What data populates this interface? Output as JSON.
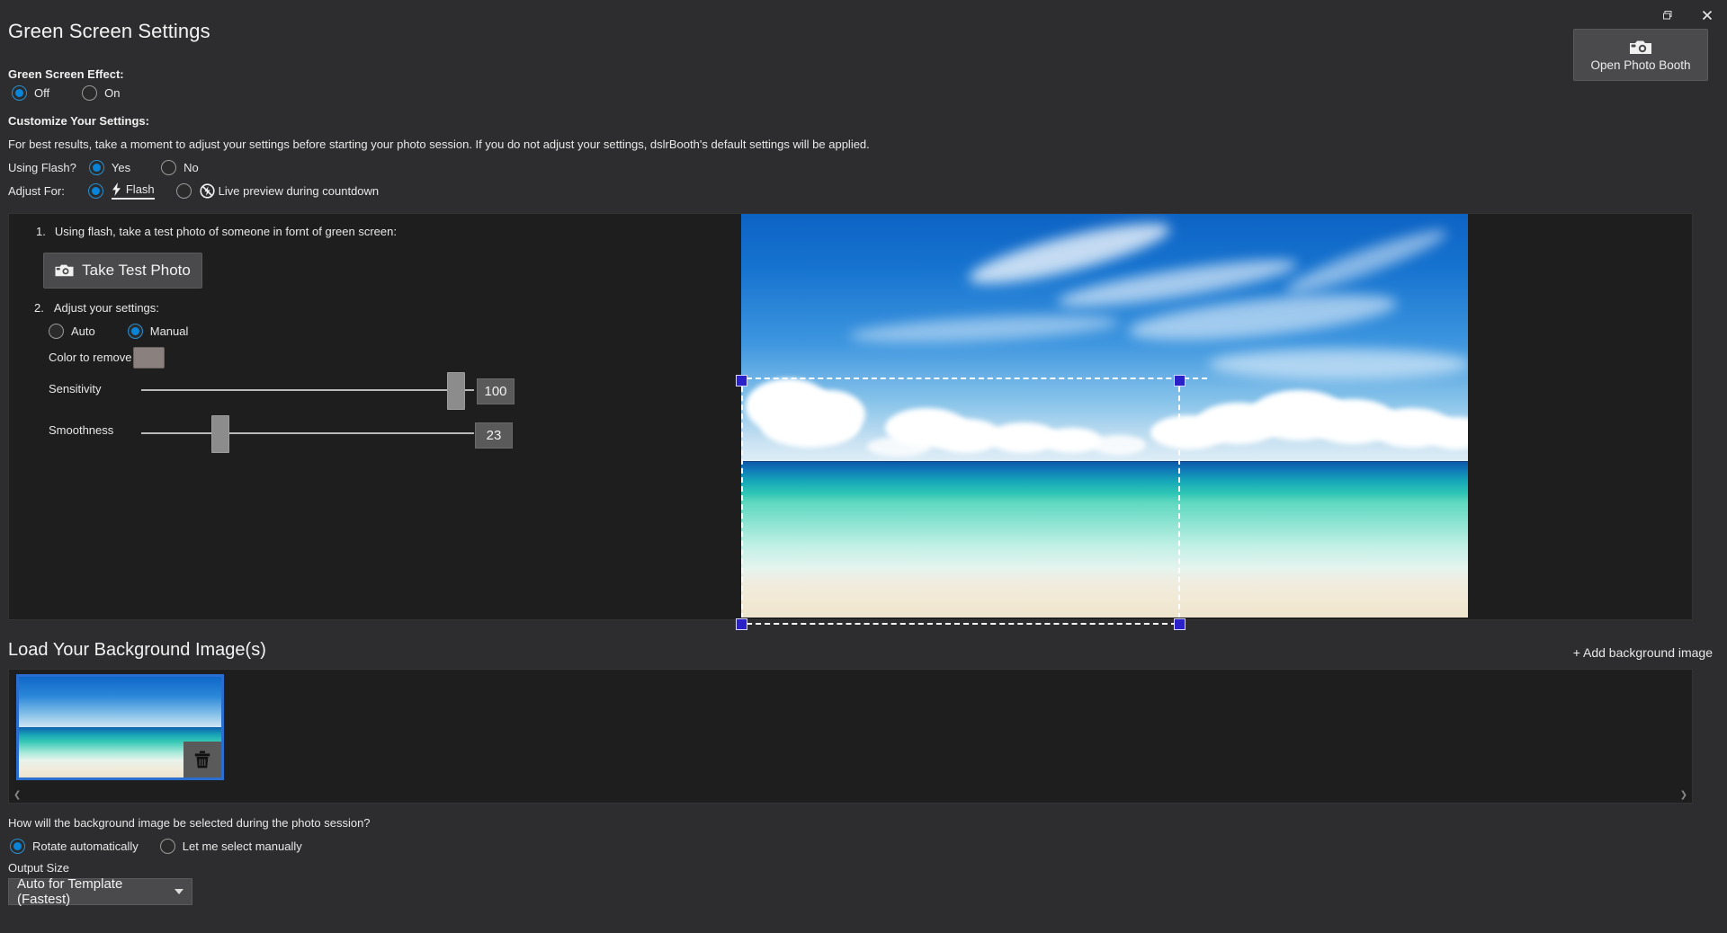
{
  "window": {
    "restore_icon": "restore-window-icon",
    "close_icon": "close-window-icon"
  },
  "page_title": "Green Screen Settings",
  "photo_booth": {
    "label": "Open Photo Booth",
    "icon": "camera-icon"
  },
  "green_screen_effect": {
    "label": "Green Screen Effect:",
    "options": [
      "Off",
      "On"
    ],
    "selected": "Off"
  },
  "customize": {
    "heading": "Customize Your Settings:",
    "description": "For best results, take a moment to adjust your settings before starting your photo session. If you do not adjust your settings, dslrBooth's default settings will be applied."
  },
  "using_flash": {
    "label": "Using Flash?",
    "options": [
      "Yes",
      "No"
    ],
    "selected": "Yes"
  },
  "adjust_for": {
    "label": "Adjust For:",
    "options": [
      {
        "label": "Flash",
        "icon": "flash-bolt-icon"
      },
      {
        "label": "Live preview during countdown",
        "icon": "flash-off-icon"
      }
    ],
    "selected": "Flash"
  },
  "steps": {
    "one": {
      "number": "1.",
      "text": "Using flash, take a test photo of someone in fornt of green screen:",
      "button_label": "Take Test Photo",
      "button_icon": "camera-icon"
    },
    "two": {
      "number": "2.",
      "text": "Adjust your settings:",
      "mode_options": [
        "Auto",
        "Manual"
      ],
      "mode_selected": "Manual"
    }
  },
  "color_to_remove": {
    "label": "Color to remove",
    "swatch_color": "#8a807e"
  },
  "sliders": [
    {
      "label": "Sensitivity",
      "value": "100",
      "percent": 97
    },
    {
      "label": "Smoothness",
      "value": "23",
      "percent": 23
    }
  ],
  "preview": {
    "alt": "beach-preview-image",
    "selection_handles": 4
  },
  "background_images": {
    "title": "Load Your Background Image(s)",
    "add_label": "+ Add background image",
    "items": [
      {
        "name": "beach-background-thumbnail",
        "delete_icon": "trash-icon",
        "selected": true
      }
    ],
    "scroll_left_icon": "chevron-left-icon",
    "scroll_right_icon": "chevron-right-icon"
  },
  "selection_mode": {
    "question": "How will the background image be selected during the photo session?",
    "options": [
      "Rotate automatically",
      "Let me select manually"
    ],
    "selected": "Rotate automatically"
  },
  "output_size": {
    "label": "Output Size",
    "value": "Auto for Template (Fastest)",
    "caret_icon": "chevron-down-icon"
  },
  "colors": {
    "accent": "#0a84d8",
    "panel_bg": "#1e1e1e",
    "window_bg": "#2d2d30",
    "handle": "#2a22c8"
  }
}
